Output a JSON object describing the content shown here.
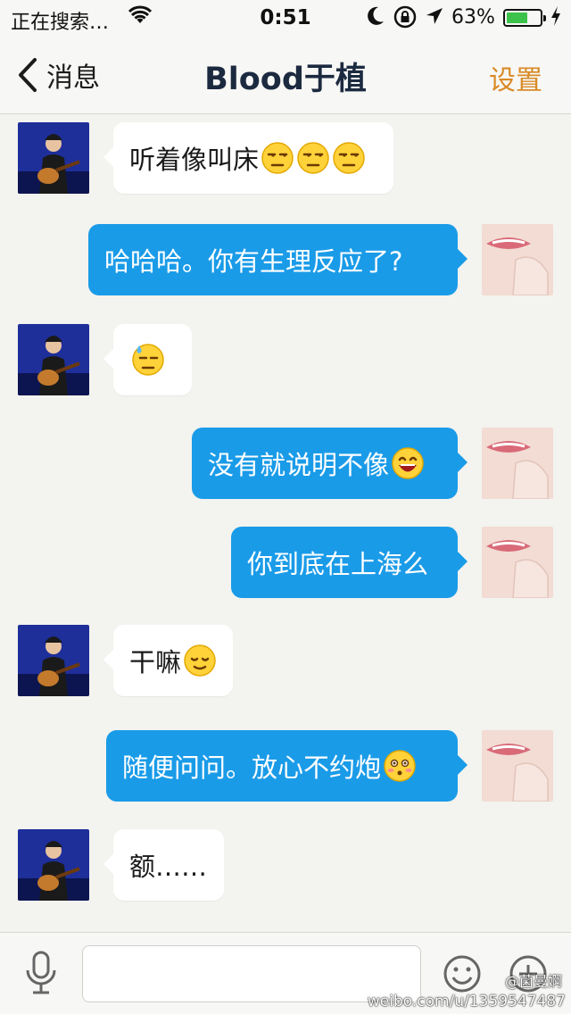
{
  "status_bar": {
    "carrier": "正在搜索…",
    "time": "0:51",
    "battery_percent": "63%",
    "battery_level": 0.63
  },
  "nav": {
    "back_label": "消息",
    "title": "Blood于植",
    "settings_label": "设置"
  },
  "messages": [
    {
      "side": "in",
      "text": "听着像叫床",
      "emoji": [
        "unamused-emoji",
        "unamused-emoji",
        "unamused-emoji"
      ]
    },
    {
      "side": "out",
      "text": "哈哈哈。你有生理反应了?",
      "emoji": []
    },
    {
      "side": "in",
      "text": "",
      "emoji": [
        "cold-sweat-emoji"
      ]
    },
    {
      "side": "out",
      "text": "没有就说明不像",
      "emoji": [
        "laughing-emoji"
      ]
    },
    {
      "side": "out",
      "text": "你到底在上海么",
      "emoji": []
    },
    {
      "side": "in",
      "text": "干嘛",
      "emoji": [
        "relieved-emoji"
      ]
    },
    {
      "side": "out",
      "text": "随便问问。放心不约炮",
      "emoji": [
        "shy-emoji"
      ]
    },
    {
      "side": "in",
      "text": "额……",
      "emoji": []
    }
  ],
  "input": {
    "placeholder": "",
    "value": ""
  },
  "watermark": {
    "handle": "@菌曼婀",
    "url": "weibo.com/u/1359547487"
  },
  "colors": {
    "outgoing_bubble": "#1a9be8",
    "incoming_bubble": "#ffffff",
    "settings_accent": "#d98a26",
    "battery_fill": "#3cc24a"
  }
}
